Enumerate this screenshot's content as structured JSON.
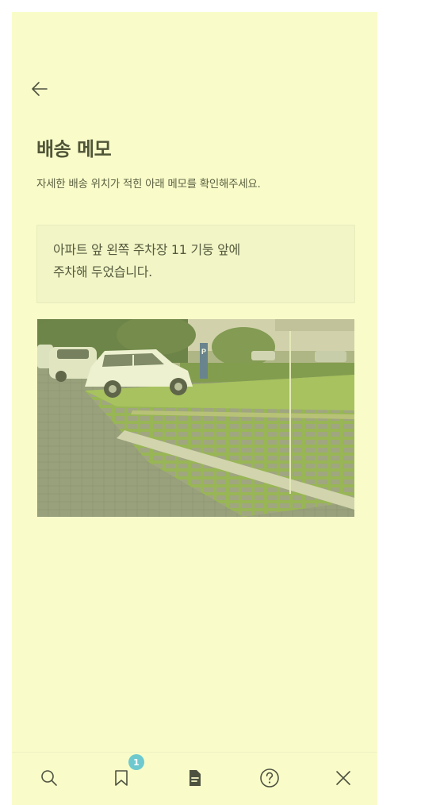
{
  "header": {
    "back_icon": "arrow-left-icon"
  },
  "page": {
    "title": "배송 메모",
    "subtitle": "자세한 배송 위치가 적힌 아래 메모를 확인해주세요."
  },
  "memo": {
    "lines": [
      "아파트 앞 왼쪽 주차장 11 기둥 앞에",
      "주차해 두었습니다."
    ]
  },
  "photo": {
    "parking_sign": "P"
  },
  "tabbar": {
    "items": [
      {
        "icon": "search-icon"
      },
      {
        "icon": "bookmark-icon",
        "badge": "1"
      },
      {
        "icon": "document-icon"
      },
      {
        "icon": "help-icon"
      },
      {
        "icon": "close-icon"
      }
    ]
  },
  "colors": {
    "background": "#f9fcc9",
    "memo_background": "#f2f5c6",
    "badge": "#6ec9cf",
    "text": "#505538",
    "icon": "#4d5240"
  }
}
